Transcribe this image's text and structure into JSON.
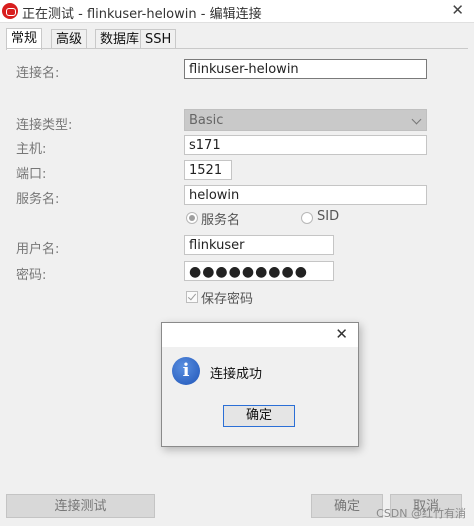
{
  "window": {
    "title": "正在测试 - flinkuser-helowin - 编辑连接"
  },
  "tabs": [
    "常规",
    "高级",
    "数据库",
    "SSH"
  ],
  "form": {
    "conn_name_label": "连接名:",
    "conn_name_value": "flinkuser-helowin",
    "conn_type_label": "连接类型:",
    "conn_type_value": "Basic",
    "host_label": "主机:",
    "host_value": "s171",
    "port_label": "端口:",
    "port_value": "1521",
    "service_label": "服务名:",
    "service_value": "helowin",
    "radio_service_name": "服务名",
    "radio_sid": "SID",
    "username_label": "用户名:",
    "username_value": "flinkuser",
    "password_label": "密码:",
    "password_mask": "●●●●●●●●●",
    "save_password_label": "保存密码"
  },
  "buttons": {
    "test": "连接测试",
    "ok": "确定",
    "cancel": "取消"
  },
  "dialog": {
    "message": "连接成功",
    "ok": "确定"
  },
  "watermark": "CSDN @红竹有消"
}
